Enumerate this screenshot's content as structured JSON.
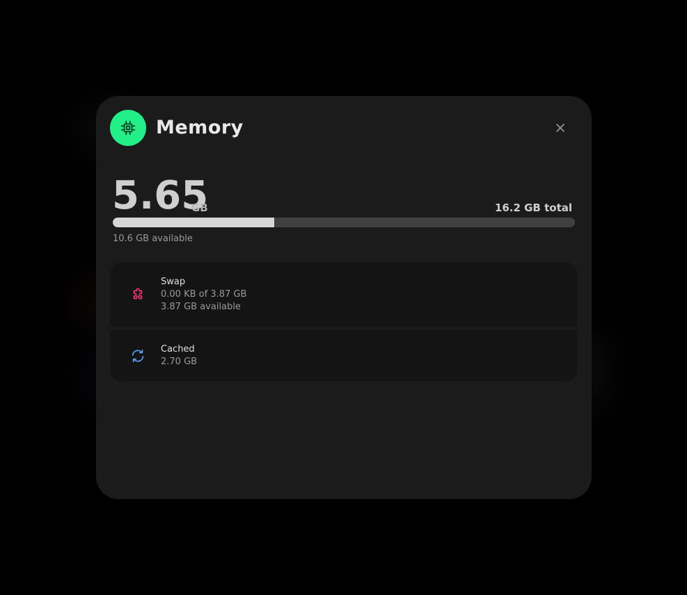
{
  "header": {
    "title": "Memory",
    "icon": "cpu-chip-icon",
    "icon_color": "#22ef88",
    "close_icon": "close-icon"
  },
  "usage": {
    "value": "5.65",
    "unit": "GB",
    "total": "16.2 GB total",
    "available": "10.6 GB available",
    "percent_used": 34.9
  },
  "items": [
    {
      "title": "Swap",
      "detail": "0.00 KB of 3.87 GB",
      "available": "3.87 GB available",
      "icon": "puzzle-icon",
      "icon_color": "#e8356e"
    },
    {
      "title": "Cached",
      "detail": "2.70 GB",
      "icon": "refresh-icon",
      "icon_color": "#5a9cf0"
    }
  ]
}
